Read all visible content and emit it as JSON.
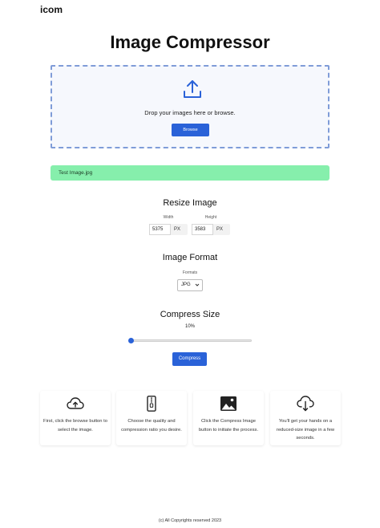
{
  "header": {
    "brand": "icom"
  },
  "page": {
    "title": "Image Compressor"
  },
  "upload": {
    "icon": "upload-icon",
    "drop_text": "Drop your images here or browse.",
    "browse_label": "Browse"
  },
  "file": {
    "name": "Test Image.jpg",
    "status_color": "#86efac"
  },
  "resize": {
    "title": "Resize Image",
    "width_label": "Width",
    "height_label": "Height",
    "width_value": "5375",
    "height_value": "3583",
    "width_unit": "PX",
    "height_unit": "PX"
  },
  "format": {
    "title": "Image Format",
    "label": "Formats",
    "selected": "JPG"
  },
  "compress": {
    "title": "Compress Size",
    "percent_text": "10%",
    "percent_value": 10,
    "button_label": "Compress"
  },
  "steps": [
    {
      "icon": "cloud-upload-icon",
      "text": "First, click the browse button to select the image."
    },
    {
      "icon": "zip-file-icon",
      "text": "Choose the quality and compression ratio you desire."
    },
    {
      "icon": "image-icon",
      "text": "Click the Compress Image button to initiate the process."
    },
    {
      "icon": "cloud-download-icon",
      "text": "You'll get your hands on a reduced-size image in a few seconds."
    }
  ],
  "footer": {
    "text": "(c) All Copyrights reserved 2023"
  },
  "colors": {
    "accent": "#2a62d8",
    "dropzone_border": "#7f9cd8",
    "success": "#86efac"
  }
}
